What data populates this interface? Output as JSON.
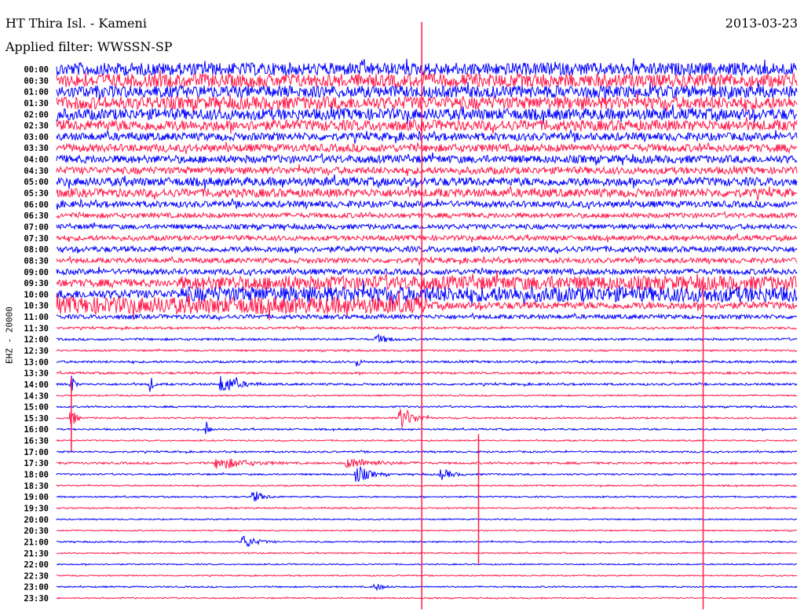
{
  "header": {
    "title": "HT Thira Isl. - Kameni",
    "date": "2013-03-23",
    "filter": "Applied filter: WWSSN-SP"
  },
  "colors": {
    "even_row": "#0000ff",
    "odd_row": "#ff1a4a"
  },
  "chart_data": {
    "type": "line",
    "subtype": "helicorder",
    "title": "HT Thira Isl. - Kameni",
    "ylabel": "EHZ - 20000",
    "row_minutes": 30,
    "row_labels": [
      "00:00",
      "00:30",
      "01:00",
      "01:30",
      "02:00",
      "02:30",
      "03:00",
      "03:30",
      "04:00",
      "04:30",
      "05:00",
      "05:30",
      "06:00",
      "06:30",
      "07:00",
      "07:30",
      "08:00",
      "08:30",
      "09:00",
      "09:30",
      "10:00",
      "10:30",
      "11:00",
      "11:30",
      "12:00",
      "12:30",
      "13:00",
      "13:30",
      "14:00",
      "14:30",
      "15:00",
      "15:30",
      "16:00",
      "16:30",
      "17:00",
      "17:30",
      "18:00",
      "18:30",
      "19:00",
      "19:30",
      "20:00",
      "20:30",
      "21:00",
      "21:30",
      "22:00",
      "22:30",
      "23:00",
      "23:30"
    ],
    "relative_noise_level": [
      0.9,
      0.95,
      0.85,
      0.9,
      0.8,
      0.75,
      0.55,
      0.55,
      0.55,
      0.5,
      0.6,
      0.6,
      0.45,
      0.35,
      0.35,
      0.35,
      0.4,
      0.35,
      0.4,
      0.9,
      1.0,
      1.0,
      0.3,
      0.15,
      0.15,
      0.12,
      0.15,
      0.15,
      0.15,
      0.1,
      0.12,
      0.12,
      0.12,
      0.1,
      0.12,
      0.15,
      0.12,
      0.1,
      0.1,
      0.1,
      0.08,
      0.08,
      0.1,
      0.08,
      0.08,
      0.08,
      0.1,
      0.08
    ],
    "events": [
      {
        "row": 24,
        "minute": 13.1,
        "amplitude": 0.4,
        "duration_min": 1.0
      },
      {
        "row": 26,
        "minute": 12.2,
        "amplitude": 0.5,
        "duration_min": 0.3
      },
      {
        "row": 28,
        "minute": 0.6,
        "amplitude": 1.2,
        "duration_min": 0.3
      },
      {
        "row": 28,
        "minute": 3.8,
        "amplitude": 1.0,
        "duration_min": 0.3
      },
      {
        "row": 28,
        "minute": 6.9,
        "amplitude": 0.8,
        "duration_min": 1.5
      },
      {
        "row": 31,
        "minute": 0.6,
        "amplitude": 1.4,
        "duration_min": 0.4
      },
      {
        "row": 31,
        "minute": 14.1,
        "amplitude": 1.0,
        "duration_min": 1.2
      },
      {
        "row": 32,
        "minute": 6.1,
        "amplitude": 0.8,
        "duration_min": 0.3
      },
      {
        "row": 35,
        "minute": 6.9,
        "amplitude": 0.5,
        "duration_min": 2.5
      },
      {
        "row": 35,
        "minute": 12.2,
        "amplitude": 0.4,
        "duration_min": 2.5
      },
      {
        "row": 36,
        "minute": 12.3,
        "amplitude": 0.8,
        "duration_min": 1.2
      },
      {
        "row": 36,
        "minute": 15.7,
        "amplitude": 0.5,
        "duration_min": 1.0
      },
      {
        "row": 38,
        "minute": 8.1,
        "amplitude": 0.5,
        "duration_min": 1.0
      },
      {
        "row": 42,
        "minute": 7.7,
        "amplitude": 0.6,
        "duration_min": 1.2
      },
      {
        "row": 46,
        "minute": 13.0,
        "amplitude": 0.3,
        "duration_min": 0.8
      }
    ],
    "large_spikes": [
      {
        "row_start": 0,
        "row_end": 48,
        "minute": 14.8
      },
      {
        "row_start": 33,
        "row_end": 44,
        "minute": 17.1
      },
      {
        "row_start": 19,
        "row_end": 48,
        "minute": 26.2
      },
      {
        "row_start": 28,
        "row_end": 34,
        "minute": 0.6
      }
    ]
  }
}
